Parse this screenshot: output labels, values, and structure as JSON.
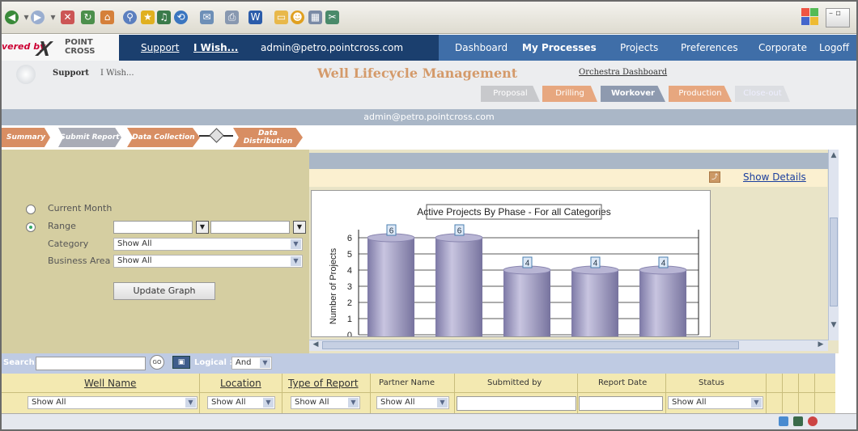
{
  "branding": {
    "powered_prefix": "vered by",
    "logo_text": "POINT CROSS"
  },
  "nav": {
    "support": "Support",
    "iwish": "I Wish...",
    "email": "admin@petro.pointcross.com",
    "tabs": [
      "Dashboard",
      "My Processes",
      "Projects",
      "Preferences",
      "Corporate",
      "Logoff"
    ],
    "active_tab": "My Processes"
  },
  "header": {
    "support": "Support",
    "iwish": "I Wish...",
    "title": "Well Lifecycle Management",
    "orchestra": "Orchestra Dashboard"
  },
  "phases": [
    {
      "label": "Proposal",
      "color": "#c8c9cc"
    },
    {
      "label": "Drilling",
      "color": "#e7a77f"
    },
    {
      "label": "Workover",
      "color": "#8e9aaf"
    },
    {
      "label": "Production",
      "color": "#e7a77f"
    },
    {
      "label": "Close-out",
      "color": "#dcdee2"
    }
  ],
  "admin_bar": "admin@petro.pointcross.com",
  "workflow": {
    "summary": "Summary",
    "submit": "Submit Report",
    "collection": "Data Collection",
    "distribution": "Data Distribution"
  },
  "filters": {
    "current_month": "Current Month",
    "range": "Range",
    "category": "Category",
    "category_value": "Show All",
    "business_area": "Business Area",
    "business_area_value": "Show All",
    "update_button": "Update Graph",
    "selected": "Range"
  },
  "details": {
    "show_details": "Show Details"
  },
  "chart_data": {
    "type": "bar",
    "title": "Active Projects By Phase - For all Categories",
    "xlabel": "",
    "ylabel": "Number of Projects",
    "categories": [
      "",
      "",
      "",
      "",
      ""
    ],
    "values": [
      6,
      6,
      4,
      4,
      4
    ],
    "yticks": [
      0,
      1,
      2,
      3,
      4,
      5,
      6
    ],
    "ylim": [
      0,
      6.5
    ],
    "grid": true,
    "bar_color": "#a6a2c6"
  },
  "search": {
    "label": "Search:",
    "value": "",
    "go": "GO",
    "logical_label": "Logical :",
    "logical_value": "And"
  },
  "table": {
    "columns": [
      "Well Name",
      "Location",
      "Type of Report",
      "Partner Name",
      "Submitted by",
      "Report Date",
      "Status"
    ],
    "filters": [
      "Show All",
      "Show All",
      "Show All",
      "Show All",
      "",
      "",
      "Show All"
    ]
  },
  "colors": {
    "nav_dark": "#1b3f6e",
    "nav_tabs": "#3f6ea8",
    "filter_bg": "#d5cea1",
    "accent": "#d49a6a"
  }
}
